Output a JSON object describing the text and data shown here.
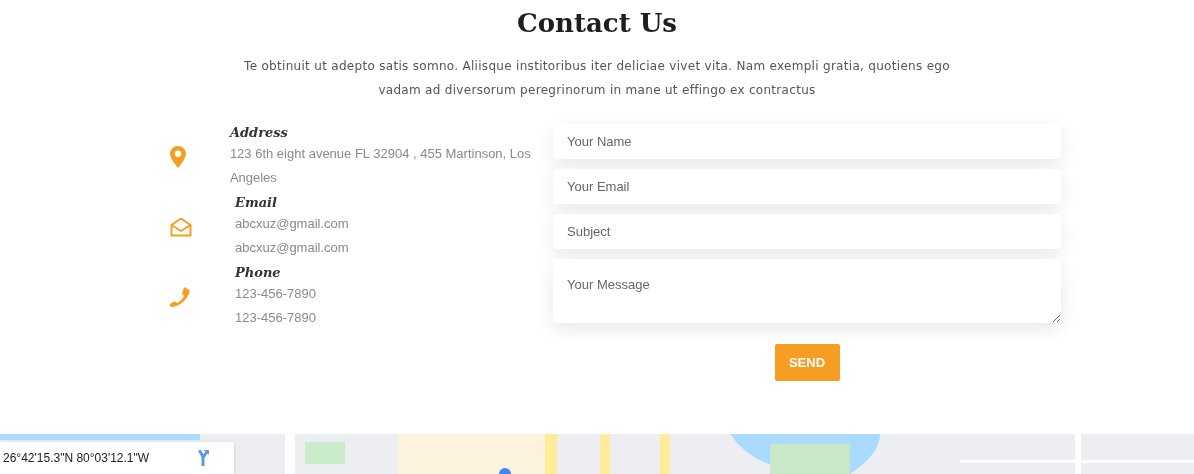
{
  "heading": "Contact Us",
  "intro": "Te obtinuit ut adepto satis somno. Aliisque institoribus iter deliciae vivet vita. Nam exempli gratia, quotiens ego vadam ad diversorum peregrinorum in mane ut effingo ex contractus",
  "info": [
    {
      "kind": "address",
      "title": "Address",
      "lines": [
        "123 6th eight avenue FL 32904 , 455 Martinson, Los Angeles"
      ]
    },
    {
      "kind": "email",
      "title": "Email",
      "lines": [
        "abcxuz@gmail.com",
        "abcxuz@gmail.com"
      ]
    },
    {
      "kind": "phone",
      "title": "Phone",
      "lines": [
        "123-456-7890",
        "123-456-7890"
      ]
    }
  ],
  "form": {
    "fields": [
      {
        "kind": "input",
        "placeholder": "Your Name"
      },
      {
        "kind": "input",
        "placeholder": "Your Email"
      },
      {
        "kind": "input",
        "placeholder": "Subject"
      },
      {
        "kind": "textarea",
        "placeholder": "Your Message"
      }
    ],
    "submit": "SEND"
  },
  "map": {
    "kind": "picture",
    "coordinates": "26°42'15.3\"N 80°03'12.1\"W"
  }
}
